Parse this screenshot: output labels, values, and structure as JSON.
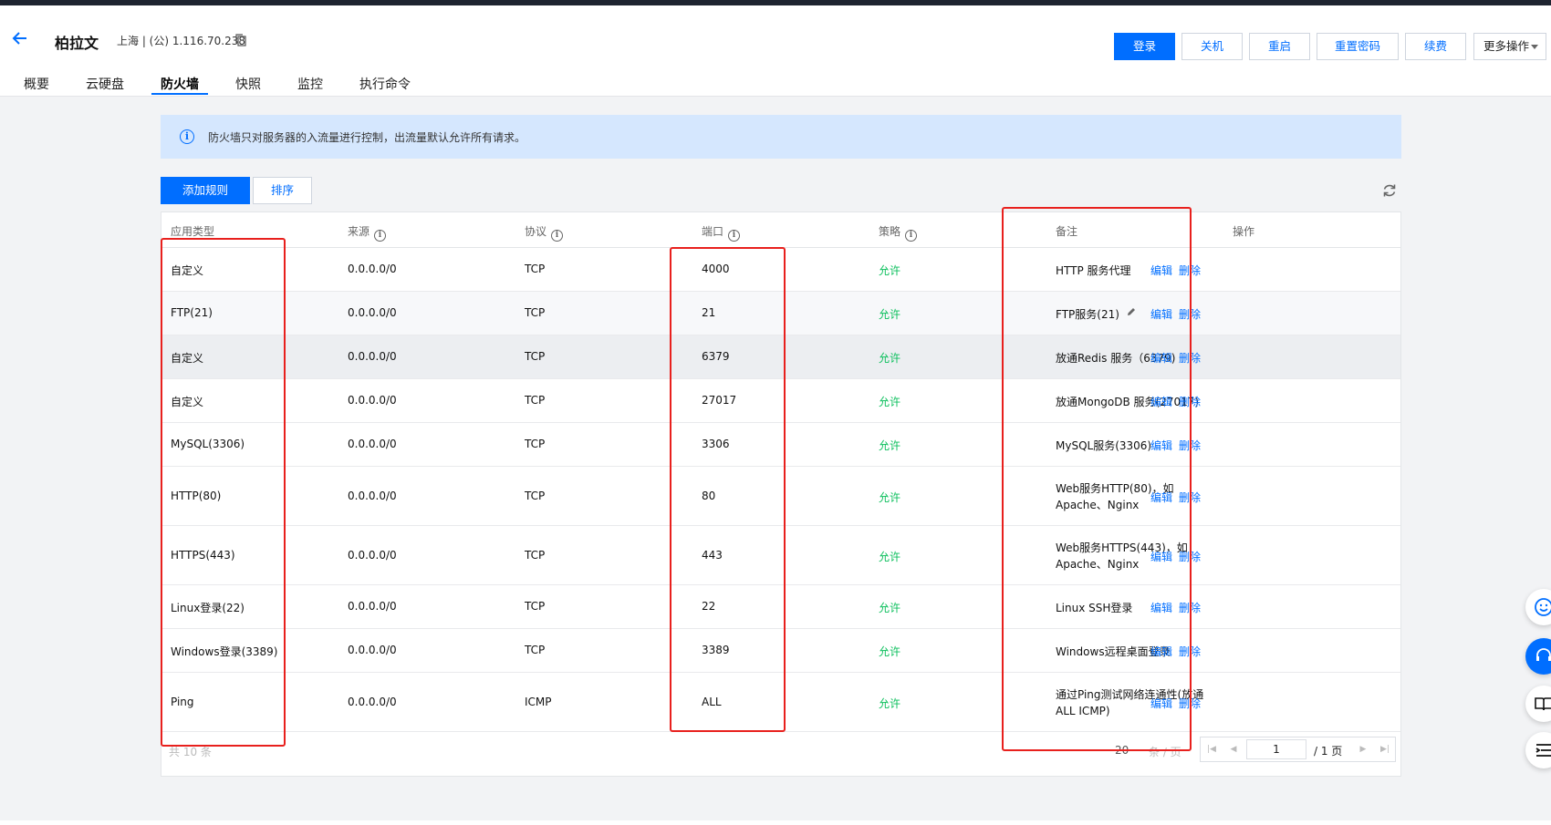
{
  "instance": {
    "name": "柏拉文",
    "address": "上海 | (公) 1.116.70.238"
  },
  "actions": [
    {
      "label": "登录",
      "primary": true
    },
    {
      "label": "关机"
    },
    {
      "label": "重启"
    },
    {
      "label": "重置密码"
    },
    {
      "label": "续费"
    },
    {
      "label": "更多操作"
    }
  ],
  "tabs": [
    "概要",
    "云硬盘",
    "防火墙",
    "快照",
    "监控",
    "执行命令"
  ],
  "active_tab": "防火墙",
  "notice": "防火墙只对服务器的入流量进行控制，出流量默认允许所有请求。",
  "toolbar": {
    "add_label": "添加规则",
    "sort_label": "排序"
  },
  "table": {
    "headers": {
      "app_type": "应用类型",
      "source": "来源",
      "protocol": "协议",
      "port": "端口",
      "policy": "策略",
      "note": "备注",
      "ops": "操作"
    },
    "rows": [
      {
        "app_type": "自定义",
        "source": "0.0.0.0/0",
        "protocol": "TCP",
        "port": "4000",
        "policy": "允许",
        "note": "HTTP 服务代理"
      },
      {
        "app_type": "FTP(21)",
        "source": "0.0.0.0/0",
        "protocol": "TCP",
        "port": "21",
        "policy": "允许",
        "note": "FTP服务(21)"
      },
      {
        "app_type": "自定义",
        "source": "0.0.0.0/0",
        "protocol": "TCP",
        "port": "6379",
        "policy": "允许",
        "note": "放通Redis 服务（6379)"
      },
      {
        "app_type": "自定义",
        "source": "0.0.0.0/0",
        "protocol": "TCP",
        "port": "27017",
        "policy": "允许",
        "note": "放通MongoDB 服务(27017)"
      },
      {
        "app_type": "MySQL(3306)",
        "source": "0.0.0.0/0",
        "protocol": "TCP",
        "port": "3306",
        "policy": "允许",
        "note": "MySQL服务(3306)"
      },
      {
        "app_type": "HTTP(80)",
        "source": "0.0.0.0/0",
        "protocol": "TCP",
        "port": "80",
        "policy": "允许",
        "note": "Web服务HTTP(80)，如 Apache、Nginx"
      },
      {
        "app_type": "HTTPS(443)",
        "source": "0.0.0.0/0",
        "protocol": "TCP",
        "port": "443",
        "policy": "允许",
        "note": "Web服务HTTPS(443)，如 Apache、Nginx"
      },
      {
        "app_type": "Linux登录(22)",
        "source": "0.0.0.0/0",
        "protocol": "TCP",
        "port": "22",
        "policy": "允许",
        "note": "Linux SSH登录"
      },
      {
        "app_type": "Windows登录(3389)",
        "source": "0.0.0.0/0",
        "protocol": "TCP",
        "port": "3389",
        "policy": "允许",
        "note": "Windows远程桌面登录"
      },
      {
        "app_type": "Ping",
        "source": "0.0.0.0/0",
        "protocol": "ICMP",
        "port": "ALL",
        "policy": "允许",
        "note": "通过Ping测试网络连通性(放通ALL ICMP)"
      }
    ],
    "row_ops": {
      "edit": "编辑",
      "delete": "删除"
    }
  },
  "footer": {
    "total": "共 10 条",
    "page_size": "20",
    "page_size_unit": "条 / 页",
    "current_page": "1",
    "total_pages": "/ 1 页"
  }
}
